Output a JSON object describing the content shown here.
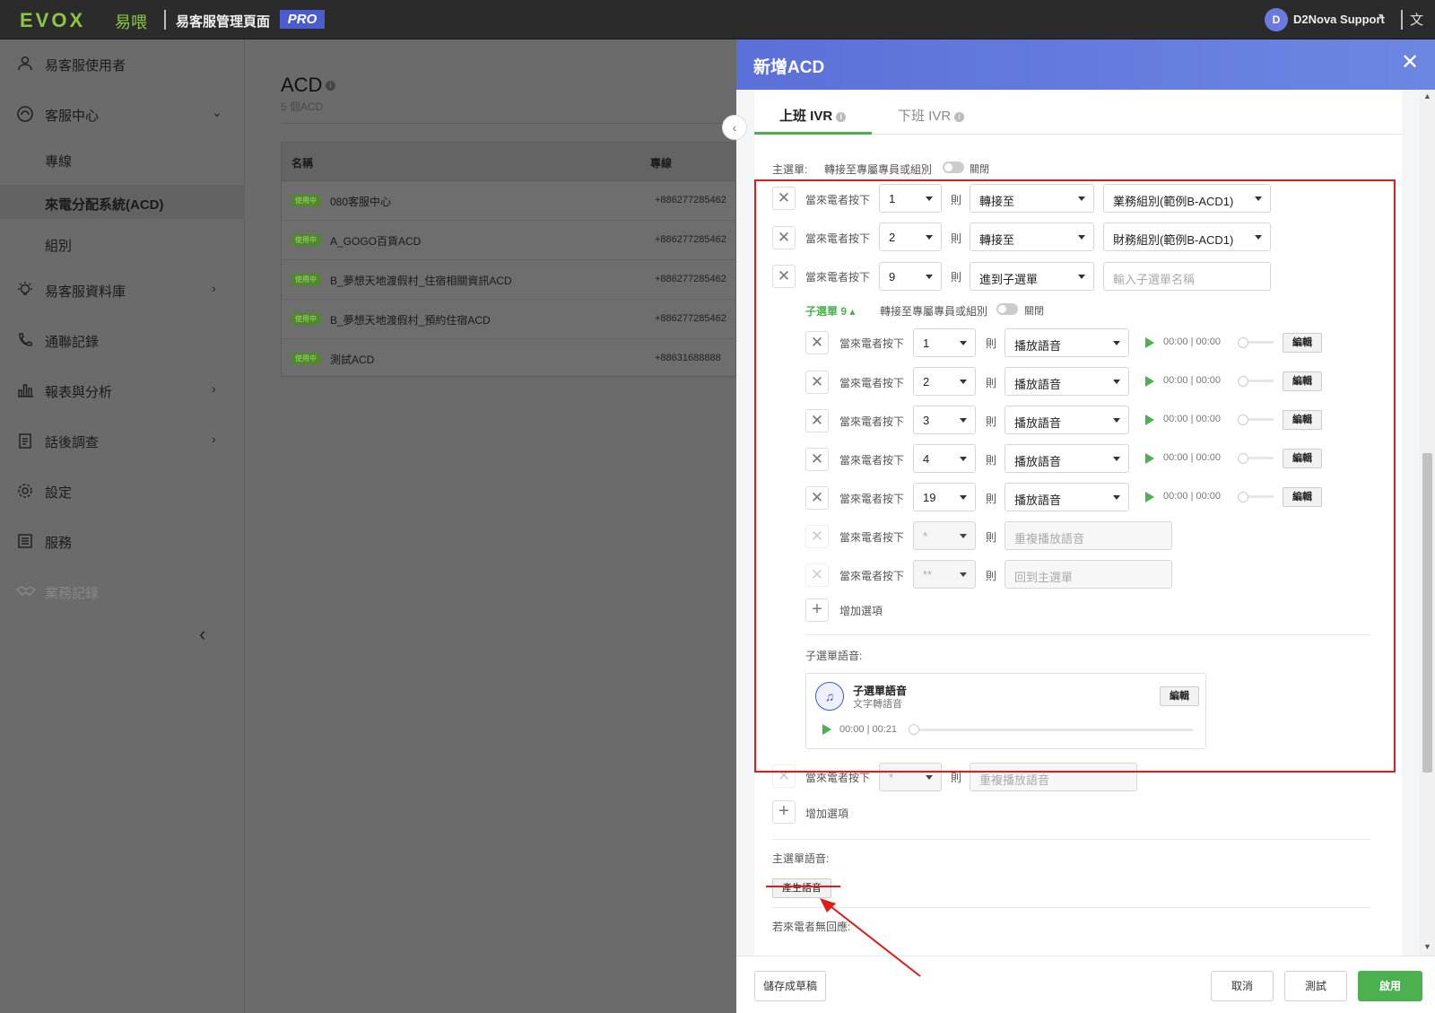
{
  "topbar": {
    "logo": "EVOX",
    "logo_cn": "易喂",
    "title": "易客服管理頁面",
    "badge": "PRO",
    "user_initial": "D",
    "user_name": "D2Nova Support",
    "lang_icon": "translate-icon"
  },
  "sidebar": {
    "items": [
      {
        "label": "易客服使用者",
        "icon": "user-icon"
      },
      {
        "label": "客服中心",
        "icon": "headset-icon"
      },
      {
        "label": "專線"
      },
      {
        "label": "來電分配系統(ACD)"
      },
      {
        "label": "組別"
      },
      {
        "label": "易客服資料庫",
        "icon": "lightbulb-icon"
      },
      {
        "label": "通聯記錄",
        "icon": "phone-log-icon"
      },
      {
        "label": "報表與分析",
        "icon": "bar-chart-icon"
      },
      {
        "label": "話後調查",
        "icon": "clipboard-icon"
      },
      {
        "label": "設定",
        "icon": "gear-icon"
      },
      {
        "label": "服務",
        "icon": "service-icon"
      },
      {
        "label": "業務記錄",
        "icon": "handshake-icon"
      }
    ]
  },
  "main": {
    "title": "ACD",
    "subtitle": "5 個ACD",
    "columns": [
      "名稱",
      "專線"
    ],
    "rows": [
      {
        "tag": "使用中",
        "name": "080客服中心",
        "phone": "+886277285462"
      },
      {
        "tag": "使用中",
        "name": "A_GOGO百貨ACD",
        "phone": "+886277285462"
      },
      {
        "tag": "使用中",
        "name": "B_夢想天地渡假村_住宿相關資訊ACD",
        "phone": "+886277285462"
      },
      {
        "tag": "使用中",
        "name": "B_夢想天地渡假村_預約住宿ACD",
        "phone": "+886277285462"
      },
      {
        "tag": "使用中",
        "name": "測試ACD",
        "phone": "+88631688888"
      }
    ]
  },
  "drawer": {
    "title": "新增ACD",
    "tabs": [
      "上班 IVR",
      "下班 IVR"
    ],
    "main_menu_label": "主選單:",
    "transfer_label": "轉接至專屬專員或組別",
    "toggle_state": "關閉",
    "when_pressed": "當來電者按下",
    "then": "則",
    "main_options": [
      {
        "key": "1",
        "action": "轉接至",
        "target": "業務組別(範例B-ACD1)"
      },
      {
        "key": "2",
        "action": "轉接至",
        "target": "財務組別(範例B-ACD1)"
      },
      {
        "key": "9",
        "action": "進到子選單",
        "target_placeholder": "輸入子選單名稱"
      }
    ],
    "submenu": {
      "title": "子選單 9",
      "transfer_label": "轉接至專屬專員或組別",
      "toggle_state": "關閉",
      "options": [
        {
          "key": "1",
          "action": "播放語音",
          "time": "00:00 | 00:00",
          "edit": "編輯"
        },
        {
          "key": "2",
          "action": "播放語音",
          "time": "00:00 | 00:00",
          "edit": "編輯"
        },
        {
          "key": "3",
          "action": "播放語音",
          "time": "00:00 | 00:00",
          "edit": "編輯"
        },
        {
          "key": "4",
          "action": "播放語音",
          "time": "00:00 | 00:00",
          "edit": "編輯"
        },
        {
          "key": "19",
          "action": "播放語音",
          "time": "00:00 | 00:00",
          "edit": "編輯"
        }
      ],
      "fixed_options": [
        {
          "key": "*",
          "action": "重複播放語音"
        },
        {
          "key": "**",
          "action": "回到主選單"
        }
      ],
      "add_option": "增加選項",
      "voice_label": "子選單語音:",
      "voice_card": {
        "title": "子選單語音",
        "subtitle": "文字轉語音",
        "edit": "編輯",
        "time": "00:00 | 00:21"
      }
    },
    "main_fixed_option": {
      "key": "*",
      "action": "重複播放語音"
    },
    "main_add_option": "增加選項",
    "main_voice_label": "主選單語音:",
    "generate_voice": "產生語音",
    "no_response_label": "若來電者無回應:",
    "footer": {
      "save_draft": "儲存成草稿",
      "cancel": "取消",
      "test": "測試",
      "enable": "啟用"
    }
  }
}
